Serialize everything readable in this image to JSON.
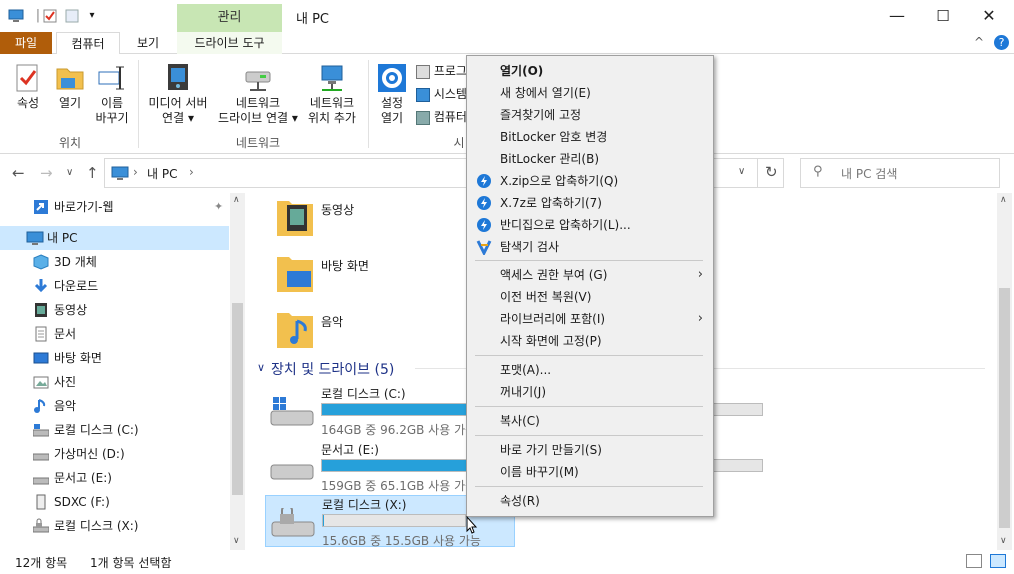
{
  "titlebar": {
    "manage_tab": "관리",
    "title": "내 PC",
    "minimize": "—",
    "maximize": "☐",
    "close": "✕"
  },
  "ribbon_tabs": {
    "file": "파일",
    "computer": "컴퓨터",
    "view": "보기",
    "drive_tools": "드라이브 도구"
  },
  "ribbon": {
    "properties": "속성",
    "open": "열기",
    "rename_l1": "이름",
    "rename_l2": "바꾸기",
    "group_location": "위치",
    "media_l1": "미디어 서버",
    "media_l2": "연결",
    "netdrive_l1": "네트워크",
    "netdrive_l2": "드라이브 연결",
    "netloc_l1": "네트워크",
    "netloc_l2": "위치 추가",
    "group_network": "네트워크",
    "settings_l1": "설정",
    "settings_l2": "열기",
    "program": "프로그",
    "system": "시스템",
    "computer": "컴퓨터",
    "group_system": "시",
    "help": "?"
  },
  "address": {
    "path_root": "내 PC",
    "search_placeholder": "내 PC 검색"
  },
  "nav": {
    "items": [
      {
        "label": "바로가기-웹"
      },
      {
        "label": "내 PC"
      },
      {
        "label": "3D 개체"
      },
      {
        "label": "다운로드"
      },
      {
        "label": "동영상"
      },
      {
        "label": "문서"
      },
      {
        "label": "바탕 화면"
      },
      {
        "label": "사진"
      },
      {
        "label": "음악"
      },
      {
        "label": "로컬 디스크 (C:)"
      },
      {
        "label": "가상머신 (D:)"
      },
      {
        "label": "문서고 (E:)"
      },
      {
        "label": "SDXC (F:)"
      },
      {
        "label": "로컬 디스크 (X:)"
      }
    ]
  },
  "content": {
    "folders": [
      {
        "label": "동영상"
      },
      {
        "label": "바탕 화면"
      },
      {
        "label": "음악"
      }
    ],
    "section_header": "장치 및 드라이브 (5)",
    "drives": [
      {
        "name": "로컬 디스크 (C:)",
        "free_text": "164GB 중 96.2GB 사용 가능",
        "used_fraction": 0.41
      },
      {
        "name": "문서고 (E:)",
        "free_text": "159GB 중 65.1GB 사용 가능",
        "used_fraction": 0.59
      },
      {
        "name": "로컬 디스크 (X:)",
        "free_text": "15.6GB 중 15.5GB 사용 가능",
        "used_fraction": 0.01
      }
    ]
  },
  "statusbar": {
    "count": "12개 항목",
    "selected": "1개 항목 선택함"
  },
  "context_menu": {
    "items": [
      {
        "label": "열기(O)"
      },
      {
        "label": "새 창에서 열기(E)"
      },
      {
        "label": "즐겨찾기에 고정"
      },
      {
        "label": "BitLocker 암호 변경"
      },
      {
        "label": "BitLocker 관리(B)"
      },
      {
        "label": "X.zip으로 압축하기(Q)"
      },
      {
        "label": "X.7z로 압축하기(7)"
      },
      {
        "label": "반디집으로 압축하기(L)..."
      },
      {
        "label": "탐색기 검사"
      },
      {
        "label": "액세스 권한 부여 (G)"
      },
      {
        "label": "이전 버전 복원(V)"
      },
      {
        "label": "라이브러리에 포함(I)"
      },
      {
        "label": "시작 화면에 고정(P)"
      },
      {
        "label": "포맷(A)..."
      },
      {
        "label": "꺼내기(J)"
      },
      {
        "label": "복사(C)"
      },
      {
        "label": "바로 가기 만들기(S)"
      },
      {
        "label": "이름 바꾸기(M)"
      },
      {
        "label": "속성(R)"
      }
    ]
  },
  "colors": {
    "accent": "#26a0da",
    "file_tab": "#b05d0a",
    "manage_tab": "#c8e6b4",
    "selection": "#cce8ff"
  }
}
